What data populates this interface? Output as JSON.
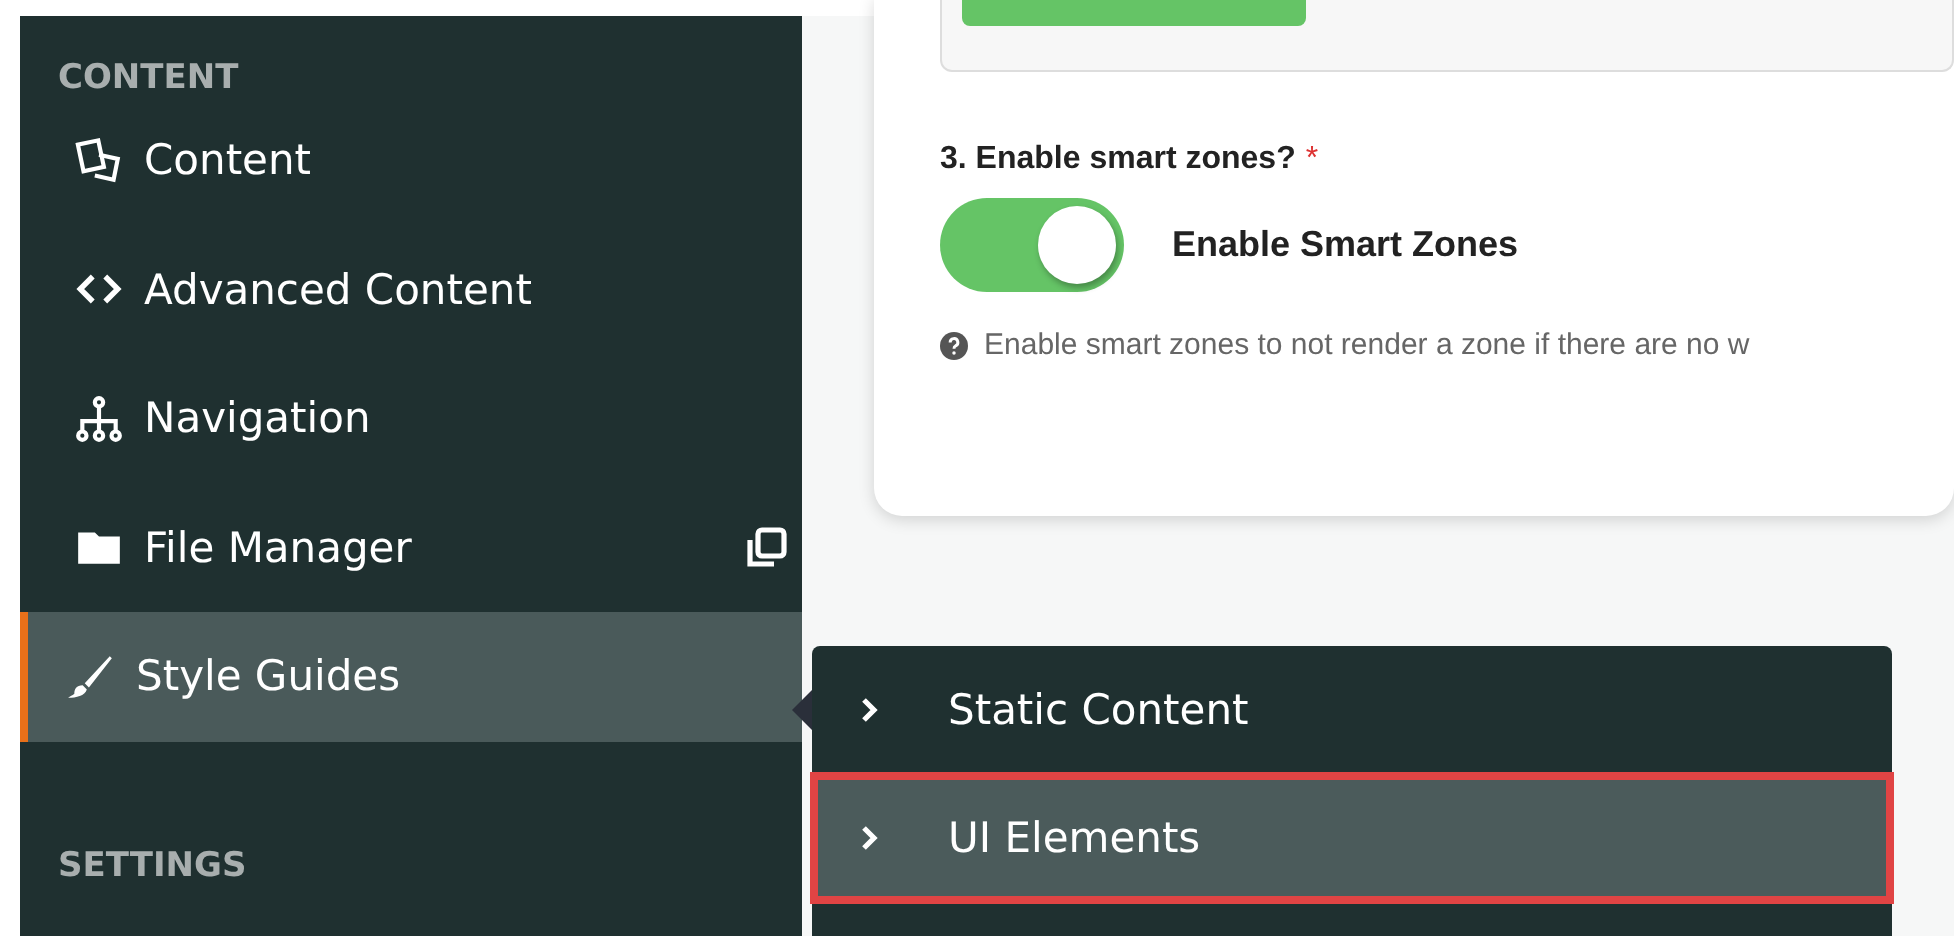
{
  "sidebar": {
    "sections": [
      {
        "heading": "CONTENT",
        "items": [
          {
            "label": "Content",
            "selected": false,
            "opens_new_window": false
          },
          {
            "label": "Advanced Content",
            "selected": false,
            "opens_new_window": false
          },
          {
            "label": "Navigation",
            "selected": false,
            "opens_new_window": false
          },
          {
            "label": "File Manager",
            "selected": false,
            "opens_new_window": true
          },
          {
            "label": "Style Guides",
            "selected": true,
            "opens_new_window": false
          }
        ]
      },
      {
        "heading": "SETTINGS"
      }
    ]
  },
  "submenu": {
    "items": [
      {
        "label": "Static Content",
        "selected": false
      },
      {
        "label": "UI Elements",
        "selected": true
      }
    ]
  },
  "form": {
    "question": "3. Enable smart zones?",
    "required_mark": "*",
    "toggle": {
      "label": "Enable Smart Zones",
      "on": true
    },
    "help": "Enable smart zones to not render a zone if there are no w"
  }
}
